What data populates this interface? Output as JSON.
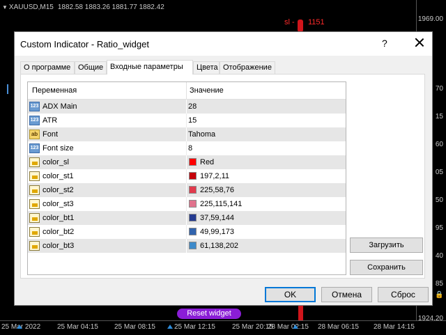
{
  "chart": {
    "symbol_line": "XAUUSD,M15",
    "prices_line": "1882.58 1883.26 1881.77 1882.42",
    "sl_label": "sl -",
    "sl_price": "1151",
    "price_ticks": [
      "1969.00",
      "70",
      "15",
      "60",
      "05",
      "50",
      "95",
      "40",
      "85",
      "1924.20"
    ],
    "time_ticks": [
      "25 Mar 2022",
      "25 Mar 04:15",
      "25 Mar 08:15",
      "25 Mar 12:15",
      "25 Mar 20:15",
      "28 Mar 02:15",
      "28 Mar 06:15",
      "28 Mar 14:15"
    ],
    "reset_widget_label": "Reset widget",
    "colors": {
      "background": "#000000",
      "axis_text": "#c8c8c8",
      "sl_red": "#ff2a2a",
      "reset_purple": "#8a1dd6"
    }
  },
  "dialog": {
    "title": "Custom Indicator - Ratio_widget",
    "help_label": "?",
    "tabs": [
      {
        "label": "О программе",
        "active": false
      },
      {
        "label": "Общие",
        "active": false
      },
      {
        "label": "Входные параметры",
        "active": true
      },
      {
        "label": "Цвета",
        "active": false
      },
      {
        "label": "Отображение",
        "active": false
      }
    ],
    "table": {
      "col_variable": "Переменная",
      "col_value": "Значение",
      "rows": [
        {
          "name": "ADX Main",
          "value": "28",
          "icon": "int-icon",
          "type_text": "123"
        },
        {
          "name": "ATR",
          "value": "15",
          "icon": "int-icon",
          "type_text": "123"
        },
        {
          "name": "Font",
          "value": "Tahoma",
          "icon": "string-icon",
          "type_text": "ab"
        },
        {
          "name": "Font size",
          "value": "8",
          "icon": "int-icon",
          "type_text": "123"
        },
        {
          "name": "color_sl",
          "value": "Red",
          "icon": "color-icon",
          "swatch": "#ff0000"
        },
        {
          "name": "color_st1",
          "value": "197,2,11",
          "icon": "color-icon",
          "swatch": "#c5020b"
        },
        {
          "name": "color_st2",
          "value": "225,58,76",
          "icon": "color-icon",
          "swatch": "#e13a4c"
        },
        {
          "name": "color_st3",
          "value": "225,115,141",
          "icon": "color-icon",
          "swatch": "#e1738d"
        },
        {
          "name": "color_bt1",
          "value": "37,59,144",
          "icon": "color-icon",
          "swatch": "#253b90"
        },
        {
          "name": "color_bt2",
          "value": "49,99,173",
          "icon": "color-icon",
          "swatch": "#3163ad"
        },
        {
          "name": "color_bt3",
          "value": "61,138,202",
          "icon": "color-icon",
          "swatch": "#3d8aca"
        }
      ]
    },
    "load_button": "Загрузить",
    "save_button": "Сохранить",
    "ok_button": "OK",
    "cancel_button": "Отмена",
    "reset_button": "Сброс"
  }
}
